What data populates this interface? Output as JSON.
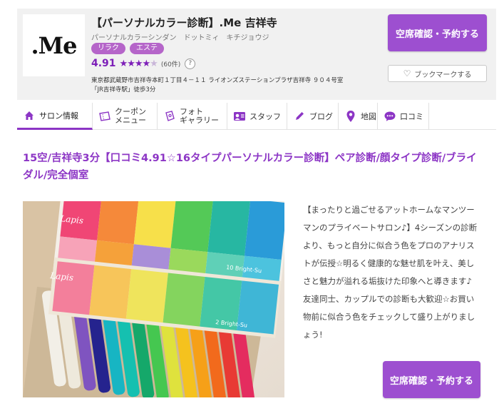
{
  "header": {
    "logo_text": ".Me",
    "salon_name": "【パーソナルカラー診断】.Me 吉祥寺",
    "salon_kana": "パーソナルカラーシンダン　ドットミィ　キチジョウジ",
    "tags": [
      "リラク",
      "エステ"
    ],
    "rating": "4.91",
    "rating_value": 4.91,
    "review_count": "(60件)",
    "help_label": "?",
    "address_line1": "東京都武蔵野市吉祥寺本町１丁目４－１１ ライオンズステーションプラザ吉祥寺 ９０４号室",
    "address_line2": "「JR吉祥寺駅」徒歩3分",
    "reserve_label": "空席確認・予約する",
    "bookmark_label": "ブックマークする"
  },
  "tabs": [
    {
      "label": "サロン情報",
      "icon": "home-icon"
    },
    {
      "label": "クーポン\nメニュー",
      "icon": "coupon-icon"
    },
    {
      "label": "フォト\nギャラリー",
      "icon": "photo-icon"
    },
    {
      "label": "スタッフ",
      "icon": "staff-icon"
    },
    {
      "label": "ブログ",
      "icon": "pen-icon"
    },
    {
      "label": "地図",
      "icon": "map-pin-icon"
    },
    {
      "label": "口コミ",
      "icon": "chat-icon"
    }
  ],
  "main": {
    "title": "15空/吉祥寺3分【口コミ4.91☆16タイプパーソナルカラー診断】ペア診断/顔タイプ診断/ブライダル/完全個室",
    "description": "【まったりと過ごせるアットホームなマンツーマンのプライベートサロン♪】4シーズンの診断より、もっと自分に似合う色をプロのアナリストが伝授☆明るく健康的な魅せ肌を叶え、美しさと魅力が溢れる垢抜けた印象へと導きます♪友達同士、カップルでの診断も大歓迎☆お買い物前に似合う色をチェックして盛り上がりましょう!",
    "reserve_label": "空席確認・予約する",
    "photo_captions": [
      "Lapis",
      "Lapis",
      "10 Bright-Su",
      "2 Bright-Su"
    ]
  },
  "colors": {
    "accent": "#8c35c5",
    "button": "#9d4fd0",
    "tag": "#b565c9",
    "header_bg": "#f1f1f1"
  }
}
